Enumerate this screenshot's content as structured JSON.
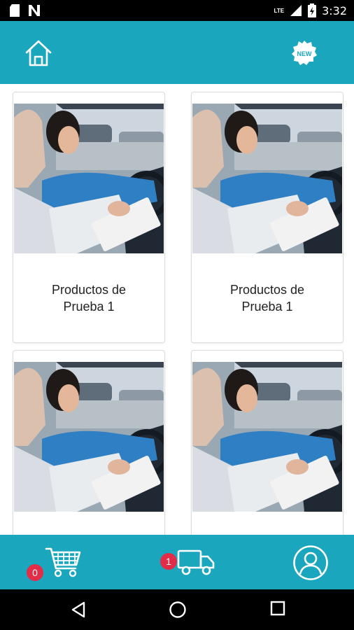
{
  "status_bar": {
    "time": "3:32",
    "network": "LTE",
    "icons": [
      "sd-card-icon",
      "n-notification-icon",
      "signal-icon",
      "battery-icon"
    ]
  },
  "top_bar": {
    "icons": [
      "home-icon",
      "new-badge-icon"
    ],
    "new_badge_label": "NEW",
    "color": "#1aa7bd"
  },
  "products": [
    {
      "title": "Productos de Prueba 1",
      "image": "driving-lesson-photo"
    },
    {
      "title": "Productos de Prueba 1",
      "image": "driving-lesson-photo"
    },
    {
      "title": "",
      "image": "driving-lesson-photo"
    },
    {
      "title": "",
      "image": "driving-lesson-photo"
    }
  ],
  "bottom_bar": {
    "cart": {
      "count": "0",
      "icon": "cart-icon"
    },
    "orders": {
      "count": "1",
      "icon": "truck-icon"
    },
    "profile": {
      "icon": "user-profile-icon"
    },
    "badge_color": "#e22d49"
  },
  "nav_bar": {
    "icons": [
      "back-icon",
      "home-circle-icon",
      "recents-icon"
    ]
  }
}
